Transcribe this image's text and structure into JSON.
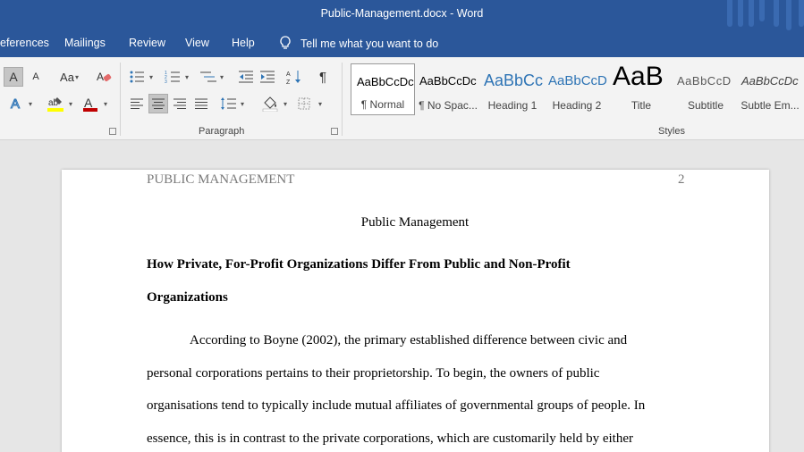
{
  "window": {
    "title": "Public-Management.docx  -  Word"
  },
  "tabs": [
    "eferences",
    "Mailings",
    "Review",
    "View",
    "Help"
  ],
  "tell_me": "Tell me what you want to do",
  "ribbon": {
    "font_buttons": {
      "grow_font": "A",
      "shrink_font": "A",
      "change_case": "Aa",
      "font_color": "A"
    },
    "group_paragraph": "Paragraph",
    "group_styles": "Styles",
    "styles": [
      {
        "preview": "AaBbCcDc",
        "name": "¶ Normal"
      },
      {
        "preview": "AaBbCcDc",
        "name": "¶ No Spac..."
      },
      {
        "preview": "AaBbCc",
        "name": "Heading 1"
      },
      {
        "preview": "AaBbCcD",
        "name": "Heading 2"
      },
      {
        "preview": "AaB",
        "name": "Title"
      },
      {
        "preview": "AaBbCcD",
        "name": "Subtitle"
      },
      {
        "preview": "AaBbCcDc",
        "name": "Subtle Em..."
      }
    ],
    "accent_colors": {
      "highlight": "#ffff00",
      "font_color": "#c00000",
      "heading_blue": "#2e74b5",
      "title_bar": "#2b579a"
    }
  },
  "document": {
    "header_left": "PUBLIC MANAGEMENT",
    "header_right": "2",
    "title": "Public Management",
    "heading_lines": [
      "How Private, For-Profit Organizations Differ From Public and Non-Profit",
      "Organizations"
    ],
    "body_lines": [
      "According to Boyne (2002), the primary established difference between civic and",
      "personal corporations pertains to their proprietorship. To begin, the owners of public",
      "organisations tend to typically include mutual affiliates of governmental groups of people. In",
      "essence, this is in contrast to the private corporations, which are customarily held by either"
    ]
  }
}
